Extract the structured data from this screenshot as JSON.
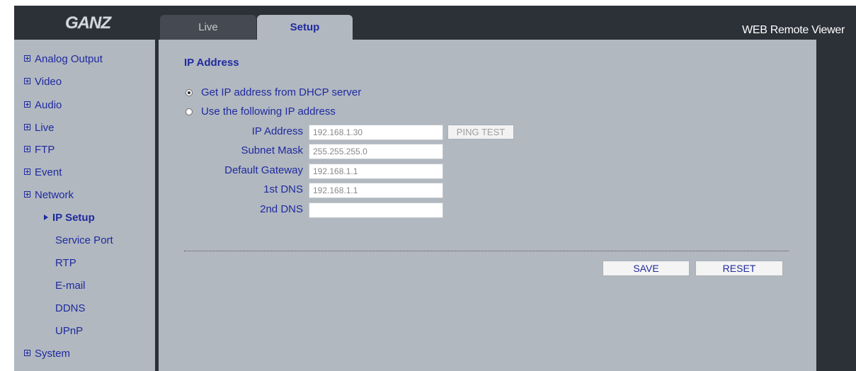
{
  "header": {
    "logo_text": "GANZ",
    "brand_title": "WEB Remote Viewer",
    "tabs": [
      {
        "label": "Live",
        "active": false
      },
      {
        "label": "Setup",
        "active": true
      }
    ]
  },
  "sidebar": {
    "items": [
      {
        "label": "Analog Output"
      },
      {
        "label": "Video"
      },
      {
        "label": "Audio"
      },
      {
        "label": "Live"
      },
      {
        "label": "FTP"
      },
      {
        "label": "Event"
      },
      {
        "label": "Network"
      },
      {
        "label": "System"
      }
    ],
    "network_sub": [
      {
        "label": "IP Setup",
        "active": true
      },
      {
        "label": "Service Port"
      },
      {
        "label": "RTP"
      },
      {
        "label": "E-mail"
      },
      {
        "label": "DDNS"
      },
      {
        "label": "UPnP"
      }
    ]
  },
  "main": {
    "section_title": "IP Address",
    "radio_dhcp": {
      "label": "Get IP address from DHCP server",
      "checked": true
    },
    "radio_static": {
      "label": "Use the following IP address",
      "checked": false
    },
    "fields": [
      {
        "label": "IP Address",
        "value": "192.168.1.30"
      },
      {
        "label": "Subnet Mask",
        "value": "255.255.255.0"
      },
      {
        "label": "Default Gateway",
        "value": "192.168.1.1"
      },
      {
        "label": "1st DNS",
        "value": "192.168.1.1"
      },
      {
        "label": "2nd DNS",
        "value": ""
      }
    ],
    "ping_test_label": "PING TEST",
    "save_label": "SAVE",
    "reset_label": "RESET"
  },
  "colors": {
    "frame": "#2c3037",
    "panel": "#b1b8c0",
    "link": "#1f2a9e"
  }
}
